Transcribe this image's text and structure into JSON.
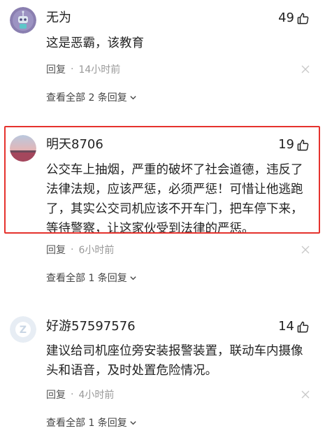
{
  "colors": {
    "highlight_border": "#e5322d",
    "meta_text": "#999999",
    "body_text": "#222222"
  },
  "comments": [
    {
      "username": "无为",
      "likes": "49",
      "text": "这是恶霸，该教育",
      "reply_label": "回复",
      "separator": "·",
      "time": "14小时前",
      "view_all": "查看全部 2 条回复",
      "avatar_icon": "robot-avatar-icon"
    },
    {
      "username": "明天8706",
      "likes": "19",
      "text": "公交车上抽烟，严重的破坏了社会道德，违反了法律法规，应该严惩，必须严惩！可惜让他逃跑了，其实公交司机应该不开车门，把车停下来，等待警察，让这家伙受到法律的严惩。",
      "reply_label": "回复",
      "separator": "·",
      "time": "6小时前",
      "view_all": "查看全部 1 条回复",
      "avatar_icon": "sunset-photo-avatar-icon"
    },
    {
      "username": "好游57597576",
      "likes": "14",
      "text": "建议给司机座位旁安装报警装置，联动车内摄像头和语音，及时处置危险情况。",
      "reply_label": "回复",
      "separator": "·",
      "time": "4小时前",
      "view_all": "查看全部 1 条回复",
      "avatar_icon": "default-avatar-icon"
    }
  ]
}
